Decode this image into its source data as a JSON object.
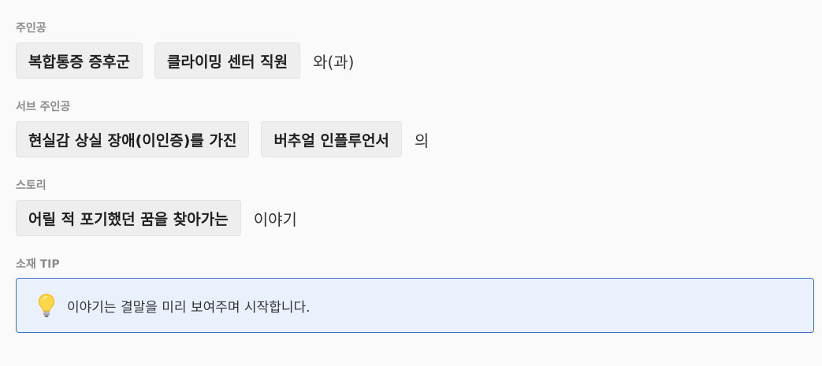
{
  "protagonist": {
    "label": "주인공",
    "chips": [
      "복합통증 증후군",
      "클라이밍 센터 직원"
    ],
    "suffix": "와(과)"
  },
  "sub_protagonist": {
    "label": "서브 주인공",
    "chips": [
      "현실감 상실 장애(이인증)를 가진",
      "버추얼 인플루언서"
    ],
    "suffix": "의"
  },
  "story": {
    "label": "스토리",
    "chips": [
      "어릴 적 포기했던 꿈을 찾아가는"
    ],
    "suffix": "이야기"
  },
  "tip": {
    "label": "소재 TIP",
    "icon": "lightbulb-icon",
    "text": "이야기는 결말을 미리 보여주며 시작합니다."
  },
  "colors": {
    "background": "#fafafa",
    "chip_background": "#eeeeee",
    "tip_background": "#eaf0fc",
    "tip_border": "#3b6fd1",
    "label": "#8a8a8a"
  }
}
